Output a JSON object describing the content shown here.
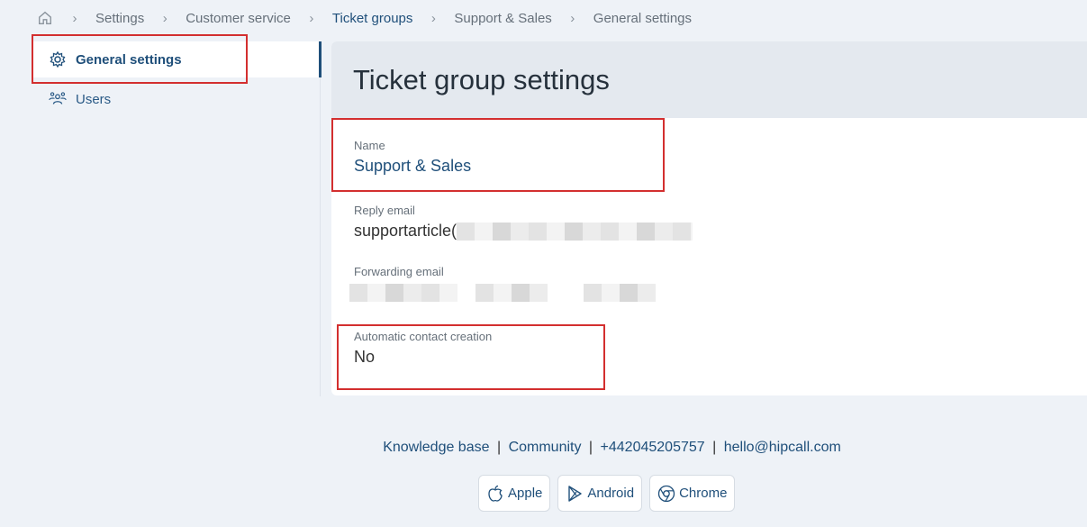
{
  "breadcrumb": {
    "home_icon": "home-icon",
    "items": [
      "Settings",
      "Customer service",
      "Ticket groups",
      "Support & Sales",
      "General settings"
    ]
  },
  "sidebar": {
    "items": [
      {
        "label": "General settings",
        "icon": "gear-icon"
      },
      {
        "label": "Users",
        "icon": "users-icon"
      }
    ]
  },
  "page": {
    "title": "Ticket group settings",
    "fields": [
      {
        "label": "Name",
        "value": "Support & Sales"
      },
      {
        "label": "Reply email",
        "value": "supportarticle("
      },
      {
        "label": "Forwarding email",
        "value": ""
      },
      {
        "label": "Automatic contact creation",
        "value": "No"
      }
    ]
  },
  "footer": {
    "links": [
      "Knowledge base",
      "Community",
      "+442045205757",
      "hello@hipcall.com"
    ],
    "separator": "|",
    "apps": [
      {
        "label": "Apple",
        "icon": "apple-icon"
      },
      {
        "label": "Android",
        "icon": "android-play-icon"
      },
      {
        "label": "Chrome",
        "icon": "chrome-icon"
      }
    ]
  },
  "colors": {
    "accent": "#1f4f7a",
    "highlight": "#d32f2f",
    "background": "#eef2f7"
  }
}
